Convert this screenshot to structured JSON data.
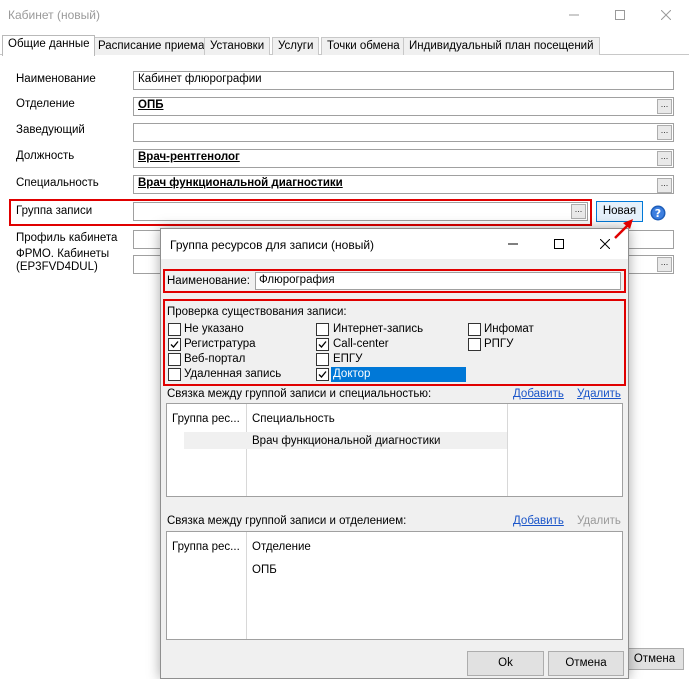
{
  "window": {
    "title": "Кабинет (новый)",
    "tabs": [
      "Общие данные",
      "Расписание приема",
      "Установки",
      "Услуги",
      "Точки обмена",
      "Индивидуальный план посещений"
    ]
  },
  "form": {
    "name_label": "Наименование",
    "name_value": "Кабинет флюрографии",
    "department_label": "Отделение",
    "department_value": "ОПБ",
    "head_label": "Заведующий",
    "head_value": "",
    "position_label": "Должность",
    "position_value": "Врач-рентгенолог",
    "specialty_label": "Специальность",
    "specialty_value": "Врач функциональной диагностики",
    "group_label": "Группа записи",
    "group_value": "",
    "new_button": "Новая",
    "profile_label": "Профиль кабинета",
    "frmo_label_1": "ФРМО. Кабинеты",
    "frmo_label_2": "(EP3FVD4DUL)",
    "ellipsis": "...",
    "cancel_button": "Отмена"
  },
  "dialog": {
    "title": "Группа ресурсов для записи (новый)",
    "name_label": "Наименование:",
    "name_value": "Флюрография",
    "check_group_label": "Проверка существования записи:",
    "checks": [
      {
        "label": "Не указано",
        "checked": false
      },
      {
        "label": "Регистратура",
        "checked": true
      },
      {
        "label": "Веб-портал",
        "checked": false
      },
      {
        "label": "Удаленная запись",
        "checked": false
      },
      {
        "label": "Интернет-запись",
        "checked": false
      },
      {
        "label": "Call-center",
        "checked": true
      },
      {
        "label": "ЕПГУ",
        "checked": false
      },
      {
        "label": "Доктор",
        "checked": true
      },
      {
        "label": "Инфомат",
        "checked": false
      },
      {
        "label": "РПГУ",
        "checked": false
      }
    ],
    "specialty_link_label": "Связка между группой записи и специальностью:",
    "add_link": "Добавить",
    "delete_link": "Удалить",
    "specialty_grid": {
      "headers": [
        "Группа рес...",
        "Специальность"
      ],
      "rows": [
        [
          "",
          "Врач функциональной диагностики"
        ]
      ]
    },
    "department_link_label": "Связка между группой записи и отделением:",
    "department_grid": {
      "headers": [
        "Группа рес...",
        "Отделение"
      ],
      "rows": [
        [
          "",
          "ОПБ"
        ]
      ]
    },
    "ok_button": "Ok",
    "cancel_button": "Отмена"
  },
  "colors": {
    "highlight_red": "#e00000",
    "selection_blue": "#0078d7",
    "link_blue": "#1a55c9"
  }
}
